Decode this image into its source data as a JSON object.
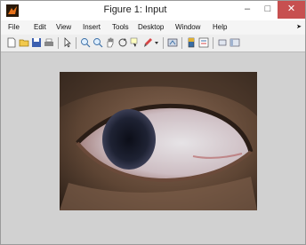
{
  "window": {
    "title": "Figure 1: Input",
    "controls": {
      "minimize": "–",
      "maximize": "□",
      "close": "✕"
    }
  },
  "menubar": {
    "items": [
      "File",
      "Edit",
      "View",
      "Insert",
      "Tools",
      "Desktop",
      "Window",
      "Help"
    ],
    "overflow": "➤"
  },
  "toolbar": {
    "icons": [
      "new-figure-icon",
      "open-icon",
      "save-icon",
      "print-icon",
      "pointer-icon",
      "zoom-in-icon",
      "zoom-out-icon",
      "pan-icon",
      "rotate-icon",
      "data-cursor-icon",
      "brush-icon",
      "link-icon",
      "colorbar-icon",
      "legend-icon",
      "hide-plot-tools-icon",
      "show-plot-tools-icon"
    ]
  },
  "image": {
    "subject": "eye-photo-icon"
  },
  "colors": {
    "canvas": "#d1d1d1",
    "close_button": "#c75050"
  }
}
